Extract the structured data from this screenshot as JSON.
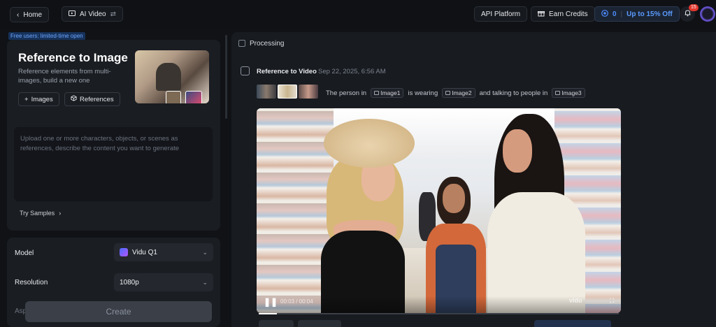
{
  "topbar": {
    "home_label": "Home",
    "mode_label": "AI Video",
    "api_label": "API Platform",
    "earn_label": "Earn Credits",
    "credits_value": "0",
    "offer_label": "Up to 15% Off",
    "notif_count": "15"
  },
  "left": {
    "free_tag": "Free users: limited-time open",
    "title": "Reference to Image",
    "description": "Reference elements from multi-images, build a new one",
    "images_btn": "Images",
    "references_btn": "References",
    "prompt_placeholder": "Upload one or more characters, objects, or scenes as references, describe the content you want to generate",
    "try_samples": "Try Samples",
    "model_label": "Model",
    "model_value": "Vidu Q1",
    "resolution_label": "Resolution",
    "resolution_value": "1080p",
    "aspect_label": "Asp",
    "create_label": "Create"
  },
  "right": {
    "processing_label": "Processing",
    "task_title": "Reference to Video",
    "task_date": "Sep 22, 2025, 6:56 AM",
    "prompt_parts": {
      "p1": "The person in",
      "t1": "Image1",
      "p2": "is wearing",
      "t2": "Image2",
      "p3": "and talking to people in",
      "t3": "Image3"
    },
    "video": {
      "time": "00:03 / 00:04",
      "watermark": "vidu",
      "progress": 0.05
    }
  },
  "colors": {
    "accent": "#4e8dff",
    "badge": "#e2372e",
    "background": "#101216",
    "panel": "#1a1d22"
  }
}
